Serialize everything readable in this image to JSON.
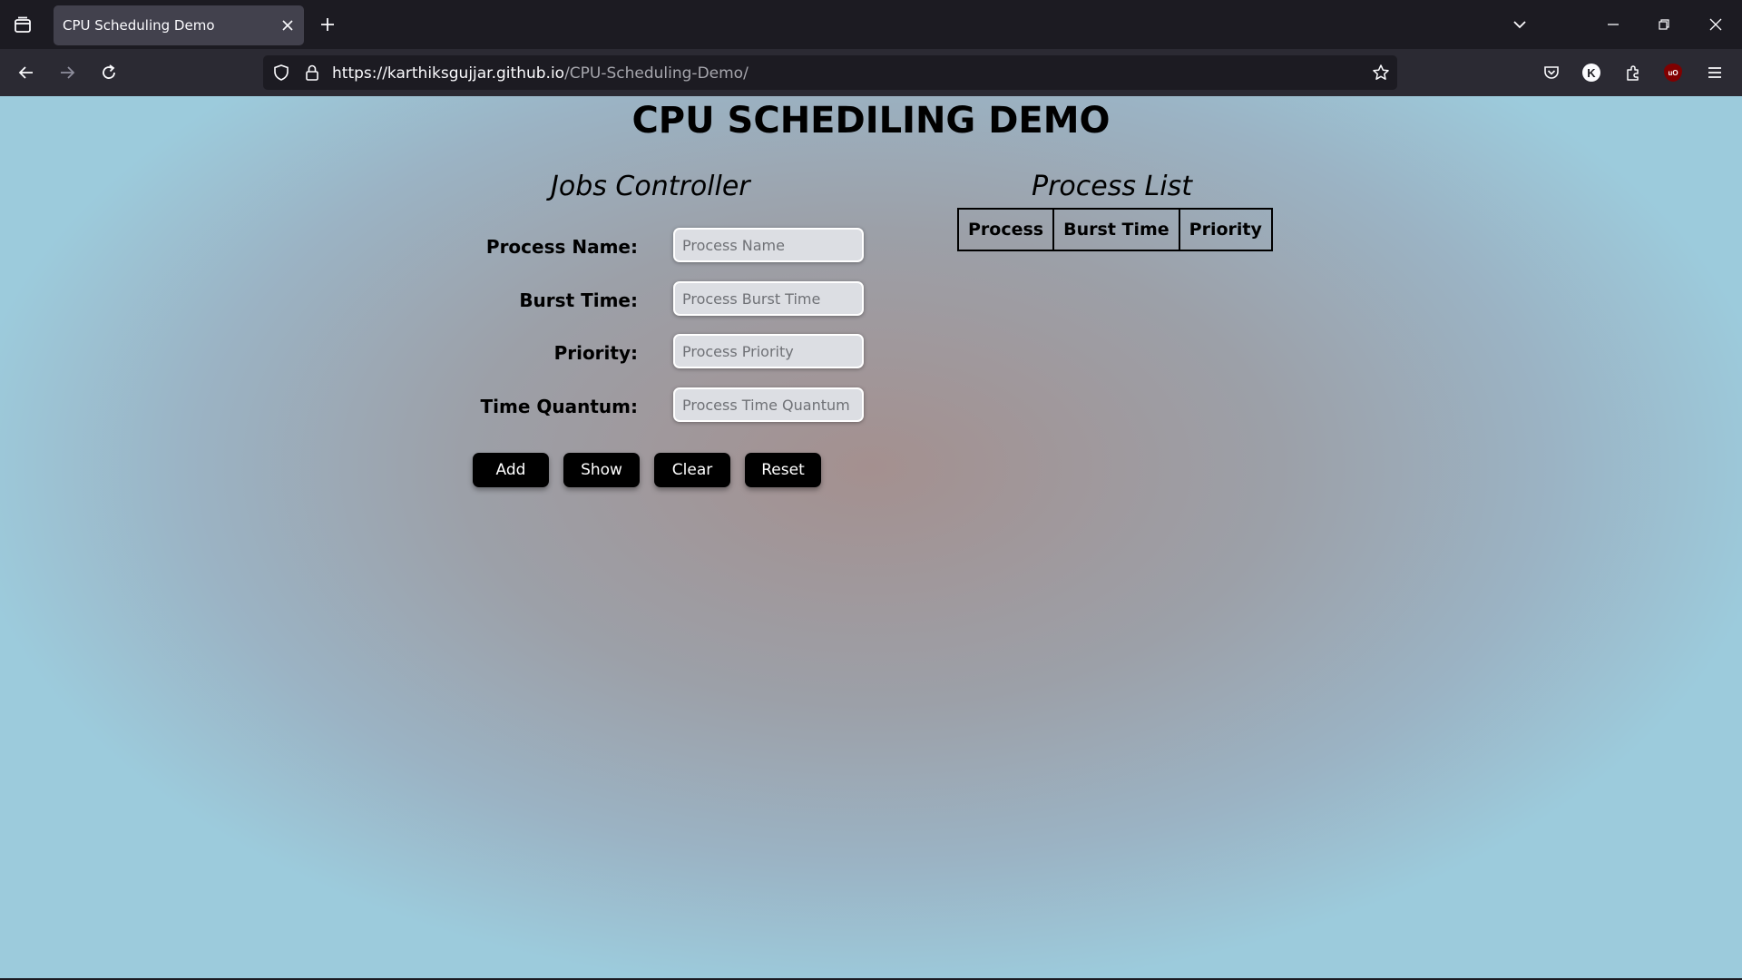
{
  "browser": {
    "tab_title": "CPU Scheduling Demo",
    "url_host": "https://karthiksgujjar.github.io",
    "url_path": "/CPU-Scheduling-Demo/",
    "profile_initial": "K",
    "ublock_label": "uO",
    "icons": [
      "tab-list-icon",
      "new-tab-icon",
      "list-all-tabs-icon",
      "minimize-icon",
      "restore-icon",
      "window-close-icon",
      "back-icon",
      "forward-icon",
      "reload-icon",
      "shield-icon",
      "lock-icon",
      "bookmark-star-icon",
      "pocket-icon",
      "extensions-icon",
      "menu-icon"
    ]
  },
  "page": {
    "title": "CPU SCHEDILING DEMO",
    "jobs_controller": {
      "heading": "Jobs Controller",
      "fields": [
        {
          "label": "Process Name:",
          "placeholder": "Process Name",
          "value": ""
        },
        {
          "label": "Burst Time:",
          "placeholder": "Process Burst Time",
          "value": ""
        },
        {
          "label": "Priority:",
          "placeholder": "Process Priority",
          "value": ""
        },
        {
          "label": "Time Quantum:",
          "placeholder": "Process Time Quantum",
          "value": ""
        }
      ],
      "buttons": {
        "add": "Add",
        "show": "Show",
        "clear": "Clear",
        "reset": "Reset"
      }
    },
    "process_list": {
      "heading": "Process List",
      "columns": [
        "Process",
        "Burst Time",
        "Priority"
      ],
      "rows": []
    }
  },
  "colors": {
    "chrome_dark": "#1c1b22",
    "chrome_toolbar": "#2b2a33",
    "tab_active": "#42414d",
    "button_bg": "#000000",
    "input_bg": "#dcdee3"
  }
}
